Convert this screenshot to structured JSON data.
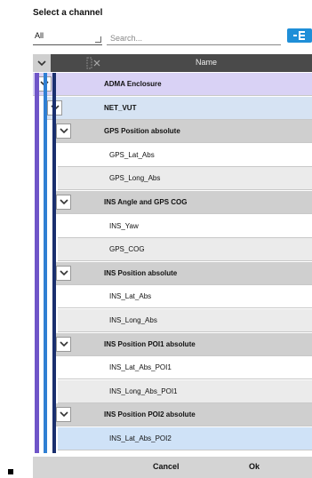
{
  "dialog": {
    "title": "Select a channel"
  },
  "filter": {
    "selected": "All",
    "options": [
      "All"
    ]
  },
  "search": {
    "placeholder": "Search..."
  },
  "header": {
    "name_label": "Name"
  },
  "tree": {
    "root": "ADMA Enclosure",
    "node": "NET_VUT",
    "groups": [
      {
        "label": "GPS Position absolute",
        "channels": [
          "GPS_Lat_Abs",
          "GPS_Long_Abs"
        ]
      },
      {
        "label": "INS Angle and GPS COG",
        "channels": [
          "INS_Yaw",
          "GPS_COG"
        ]
      },
      {
        "label": "INS Position absolute",
        "channels": [
          "INS_Lat_Abs",
          "INS_Long_Abs"
        ]
      },
      {
        "label": "INS Position POI1 absolute",
        "channels": [
          "INS_Lat_Abs_POI1",
          "INS_Long_Abs_POI1"
        ]
      },
      {
        "label": "INS Position POI2 absolute",
        "channels": [
          "INS_Lat_Abs_POI2"
        ]
      }
    ]
  },
  "footer": {
    "cancel_label": "Cancel",
    "ok_label": "Ok"
  },
  "colors": {
    "root_row": "#d9d2f5",
    "node_row": "#d6e3f3",
    "group_row": "#cfcfcf",
    "channel_odd": "#ffffff",
    "channel_even": "#ebebeb",
    "selected_row": "#cfe2f7",
    "rail_purple": "#6f55c8",
    "rail_blue": "#2f7fd3",
    "rail_navy": "#1a2f6e",
    "accent": "#1f8fd8"
  },
  "icons": {
    "tree_toggle": "tree-structure-icon",
    "collapse": "chevron-down-icon",
    "clear_filter": "clear-filter-icon"
  }
}
